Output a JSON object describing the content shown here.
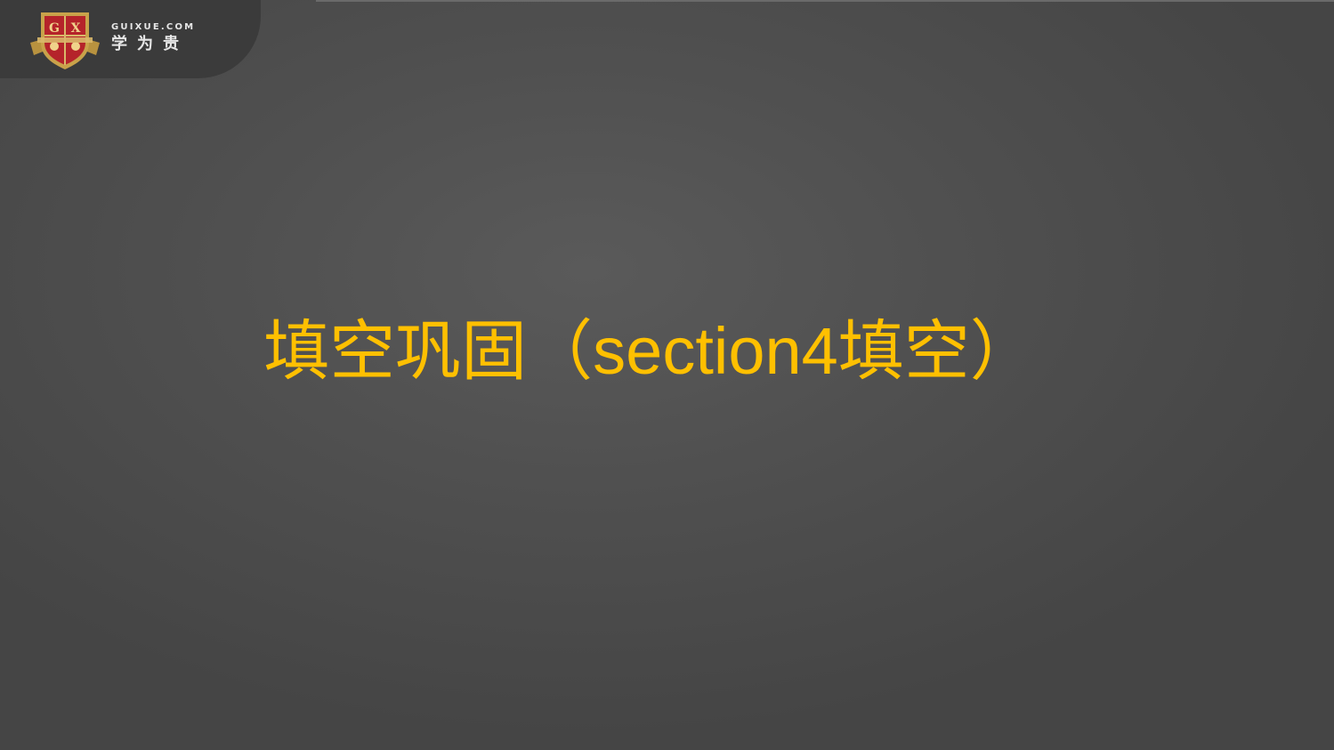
{
  "logo": {
    "domain": "GUIXUE.COM",
    "name": "学为贵"
  },
  "slide": {
    "title": "填空巩固（section4填空）"
  },
  "colors": {
    "title": "#ffc000",
    "logo_red": "#b5232a",
    "logo_gold": "#c9a24a"
  }
}
